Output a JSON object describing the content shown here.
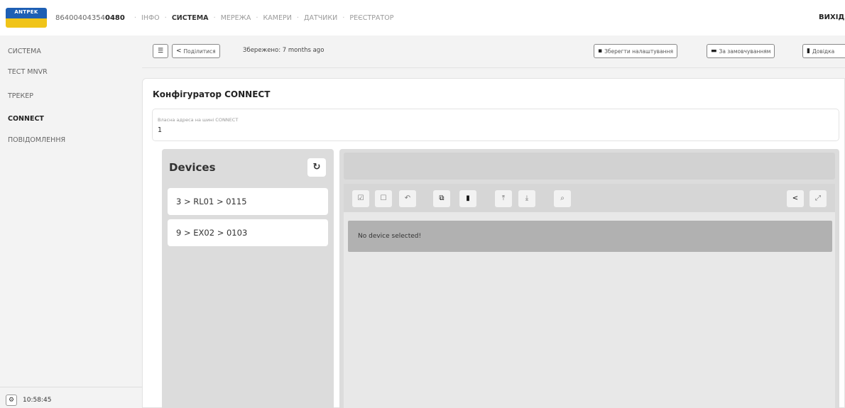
{
  "header": {
    "logo_text": "ANTPEK",
    "serial_prefix": "86400404354",
    "serial_bold": "0480",
    "nav": [
      "ІНФО",
      "СИСТЕМА",
      "МЕРЕЖА",
      "КАМЕРИ",
      "ДАТЧИКИ",
      "РЕЄСТРАТОР"
    ],
    "active_nav": "СИСТЕМА",
    "exit_label": "ВИХІД"
  },
  "sidebar": {
    "items": [
      "СИСТЕМА",
      "ТЕСТ MNVR",
      "ТРЕКЕР",
      "CONNECT",
      "ПОВІДОМЛЕННЯ"
    ],
    "active_item": "CONNECT",
    "clock": "10:58:45"
  },
  "toolbar": {
    "share_label": "Поділитися",
    "saved_text": "Збережено: 7 months ago",
    "save_settings_label": "Зберегти налаштування",
    "defaults_label": "За замовчуванням",
    "help_label": "Довідка"
  },
  "configurator": {
    "title": "Конфігуратор CONNECT",
    "field_label": "Власна адреса на шині CONNECT",
    "field_value": "1"
  },
  "devices": {
    "title": "Devices",
    "items": [
      "3 > RL01 > 0115",
      "9 > EX02 > 0103"
    ]
  },
  "detail": {
    "empty_message": "No device selected!"
  },
  "icons": {
    "menu": "menu-icon",
    "share": "share-icon",
    "save": "save-icon",
    "defaults": "keyboard-icon",
    "help": "book-icon",
    "refresh": "refresh-icon",
    "settings": "gear-icon"
  }
}
